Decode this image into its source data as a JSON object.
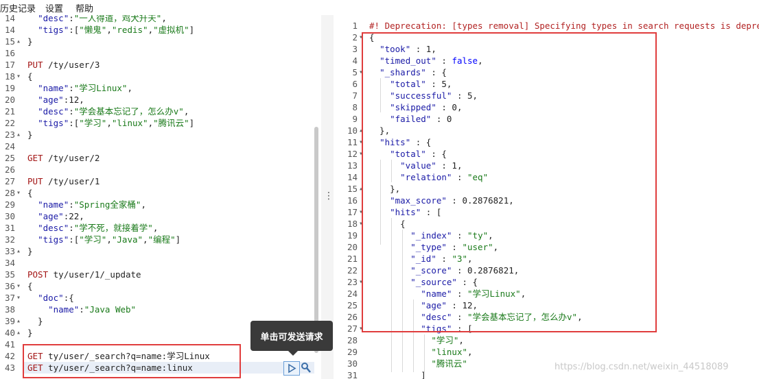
{
  "menu": {
    "history": "历史记录",
    "settings": "设置",
    "help": "帮助"
  },
  "tooltip": "单击可发送请求",
  "watermark": "https://blog.csdn.net/weixin_44518089",
  "left_editor": {
    "lines": [
      {
        "n": "14",
        "fold": "",
        "text": [
          [
            "  ",
            "tk-plain"
          ],
          [
            "\"desc\"",
            "tk-key"
          ],
          [
            ":",
            "tk-plain"
          ],
          [
            "\"一人得道，鸡犬升天\"",
            "tk-str"
          ],
          [
            ",",
            "tk-plain"
          ]
        ]
      },
      {
        "n": "14",
        "fold": "",
        "text": [
          [
            "  ",
            "tk-plain"
          ],
          [
            "\"tigs\"",
            "tk-key"
          ],
          [
            ":[",
            "tk-plain"
          ],
          [
            "\"懒鬼\"",
            "tk-str"
          ],
          [
            ",",
            "tk-plain"
          ],
          [
            "\"redis\"",
            "tk-str"
          ],
          [
            ",",
            "tk-plain"
          ],
          [
            "\"虚拟机\"",
            "tk-str"
          ],
          [
            "]",
            "tk-plain"
          ]
        ]
      },
      {
        "n": "15",
        "fold": "▴",
        "text": [
          [
            "}",
            "tk-plain"
          ]
        ]
      },
      {
        "n": "16",
        "fold": "",
        "text": []
      },
      {
        "n": "17",
        "fold": "",
        "text": [
          [
            "PUT ",
            "tk-kw"
          ],
          [
            "/ty/user/3",
            "tk-plain"
          ]
        ]
      },
      {
        "n": "18",
        "fold": "▾",
        "text": [
          [
            "{",
            "tk-plain"
          ]
        ]
      },
      {
        "n": "19",
        "fold": "",
        "text": [
          [
            "  ",
            "tk-plain"
          ],
          [
            "\"name\"",
            "tk-key"
          ],
          [
            ":",
            "tk-plain"
          ],
          [
            "\"学习Linux\"",
            "tk-str"
          ],
          [
            ",",
            "tk-plain"
          ]
        ]
      },
      {
        "n": "20",
        "fold": "",
        "text": [
          [
            "  ",
            "tk-plain"
          ],
          [
            "\"age\"",
            "tk-key"
          ],
          [
            ":12,",
            "tk-plain"
          ]
        ]
      },
      {
        "n": "21",
        "fold": "",
        "text": [
          [
            "  ",
            "tk-plain"
          ],
          [
            "\"desc\"",
            "tk-key"
          ],
          [
            ":",
            "tk-plain"
          ],
          [
            "\"学会基本忘记了，怎么办v\"",
            "tk-str"
          ],
          [
            ",",
            "tk-plain"
          ]
        ]
      },
      {
        "n": "22",
        "fold": "",
        "text": [
          [
            "  ",
            "tk-plain"
          ],
          [
            "\"tigs\"",
            "tk-key"
          ],
          [
            ":[",
            "tk-plain"
          ],
          [
            "\"学习\"",
            "tk-str"
          ],
          [
            ",",
            "tk-plain"
          ],
          [
            "\"linux\"",
            "tk-str"
          ],
          [
            ",",
            "tk-plain"
          ],
          [
            "\"腾讯云\"",
            "tk-str"
          ],
          [
            "]",
            "tk-plain"
          ]
        ]
      },
      {
        "n": "23",
        "fold": "▴",
        "text": [
          [
            "}",
            "tk-plain"
          ]
        ]
      },
      {
        "n": "24",
        "fold": "",
        "text": []
      },
      {
        "n": "25",
        "fold": "",
        "text": [
          [
            "GET ",
            "tk-kw"
          ],
          [
            "/ty/user/2",
            "tk-plain"
          ]
        ]
      },
      {
        "n": "26",
        "fold": "",
        "text": []
      },
      {
        "n": "27",
        "fold": "",
        "text": [
          [
            "PUT ",
            "tk-kw"
          ],
          [
            "/ty/user/1",
            "tk-plain"
          ]
        ]
      },
      {
        "n": "28",
        "fold": "▾",
        "text": [
          [
            "{",
            "tk-plain"
          ]
        ]
      },
      {
        "n": "29",
        "fold": "",
        "text": [
          [
            "  ",
            "tk-plain"
          ],
          [
            "\"name\"",
            "tk-key"
          ],
          [
            ":",
            "tk-plain"
          ],
          [
            "\"Spring全家桶\"",
            "tk-str"
          ],
          [
            ",",
            "tk-plain"
          ]
        ]
      },
      {
        "n": "30",
        "fold": "",
        "text": [
          [
            "  ",
            "tk-plain"
          ],
          [
            "\"age\"",
            "tk-key"
          ],
          [
            ":22,",
            "tk-plain"
          ]
        ]
      },
      {
        "n": "31",
        "fold": "",
        "text": [
          [
            "  ",
            "tk-plain"
          ],
          [
            "\"desc\"",
            "tk-key"
          ],
          [
            ":",
            "tk-plain"
          ],
          [
            "\"学不死，就接着学\"",
            "tk-str"
          ],
          [
            ",",
            "tk-plain"
          ]
        ]
      },
      {
        "n": "32",
        "fold": "",
        "text": [
          [
            "  ",
            "tk-plain"
          ],
          [
            "\"tigs\"",
            "tk-key"
          ],
          [
            ":[",
            "tk-plain"
          ],
          [
            "\"学习\"",
            "tk-str"
          ],
          [
            ",",
            "tk-plain"
          ],
          [
            "\"Java\"",
            "tk-str"
          ],
          [
            ",",
            "tk-plain"
          ],
          [
            "\"编程\"",
            "tk-str"
          ],
          [
            "]",
            "tk-plain"
          ]
        ]
      },
      {
        "n": "33",
        "fold": "▴",
        "text": [
          [
            "}",
            "tk-plain"
          ]
        ]
      },
      {
        "n": "34",
        "fold": "",
        "text": []
      },
      {
        "n": "35",
        "fold": "",
        "text": [
          [
            "POST ",
            "tk-kw"
          ],
          [
            "ty/user/1/_update",
            "tk-plain"
          ]
        ]
      },
      {
        "n": "36",
        "fold": "▾",
        "text": [
          [
            "{",
            "tk-plain"
          ]
        ]
      },
      {
        "n": "37",
        "fold": "▾",
        "text": [
          [
            "  ",
            "tk-plain"
          ],
          [
            "\"doc\"",
            "tk-key"
          ],
          [
            ":{",
            "tk-plain"
          ]
        ]
      },
      {
        "n": "38",
        "fold": "",
        "text": [
          [
            "    ",
            "tk-plain"
          ],
          [
            "\"name\"",
            "tk-key"
          ],
          [
            ":",
            "tk-plain"
          ],
          [
            "\"Java Web\"",
            "tk-str"
          ]
        ]
      },
      {
        "n": "39",
        "fold": "▴",
        "text": [
          [
            "  }",
            "tk-plain"
          ]
        ]
      },
      {
        "n": "40",
        "fold": "▴",
        "text": [
          [
            "}",
            "tk-plain"
          ]
        ]
      },
      {
        "n": "41",
        "fold": "",
        "text": []
      },
      {
        "n": "42",
        "fold": "",
        "text": [
          [
            "GET ",
            "tk-kw"
          ],
          [
            "ty/user/_search?q=name:学习Linux",
            "tk-plain"
          ]
        ]
      },
      {
        "n": "43",
        "fold": "",
        "text": [
          [
            "GET ",
            "tk-kw"
          ],
          [
            "ty/user/_search?q=name:linux",
            "tk-plain"
          ]
        ]
      }
    ]
  },
  "right_editor": {
    "lines": [
      {
        "n": "1",
        "fold": "",
        "text": [
          [
            "#! Deprecation: [types removal] Specifying types in search requests is deprecated.",
            "tk-comment"
          ]
        ]
      },
      {
        "n": "2",
        "fold": "▾",
        "text": [
          [
            "{",
            "tk-plain"
          ]
        ]
      },
      {
        "n": "3",
        "fold": "",
        "text": [
          [
            "  ",
            "tk-plain"
          ],
          [
            "\"took\"",
            "tk-key"
          ],
          [
            " : 1,",
            "tk-plain"
          ]
        ]
      },
      {
        "n": "4",
        "fold": "",
        "text": [
          [
            "  ",
            "tk-plain"
          ],
          [
            "\"timed_out\"",
            "tk-key"
          ],
          [
            " : ",
            "tk-plain"
          ],
          [
            "false",
            "tk-bool"
          ],
          [
            ",",
            "tk-plain"
          ]
        ]
      },
      {
        "n": "5",
        "fold": "▾",
        "text": [
          [
            "  ",
            "tk-plain"
          ],
          [
            "\"_shards\"",
            "tk-key"
          ],
          [
            " : {",
            "tk-plain"
          ]
        ]
      },
      {
        "n": "6",
        "fold": "",
        "text": [
          [
            "    ",
            "tk-plain"
          ],
          [
            "\"total\"",
            "tk-key"
          ],
          [
            " : 5,",
            "tk-plain"
          ]
        ]
      },
      {
        "n": "7",
        "fold": "",
        "text": [
          [
            "    ",
            "tk-plain"
          ],
          [
            "\"successful\"",
            "tk-key"
          ],
          [
            " : 5,",
            "tk-plain"
          ]
        ]
      },
      {
        "n": "8",
        "fold": "",
        "text": [
          [
            "    ",
            "tk-plain"
          ],
          [
            "\"skipped\"",
            "tk-key"
          ],
          [
            " : 0,",
            "tk-plain"
          ]
        ]
      },
      {
        "n": "9",
        "fold": "",
        "text": [
          [
            "    ",
            "tk-plain"
          ],
          [
            "\"failed\"",
            "tk-key"
          ],
          [
            " : 0",
            "tk-plain"
          ]
        ]
      },
      {
        "n": "10",
        "fold": "▴",
        "text": [
          [
            "  },",
            "tk-plain"
          ]
        ]
      },
      {
        "n": "11",
        "fold": "▾",
        "text": [
          [
            "  ",
            "tk-plain"
          ],
          [
            "\"hits\"",
            "tk-key"
          ],
          [
            " : {",
            "tk-plain"
          ]
        ]
      },
      {
        "n": "12",
        "fold": "▾",
        "text": [
          [
            "    ",
            "tk-plain"
          ],
          [
            "\"total\"",
            "tk-key"
          ],
          [
            " : {",
            "tk-plain"
          ]
        ]
      },
      {
        "n": "13",
        "fold": "",
        "text": [
          [
            "      ",
            "tk-plain"
          ],
          [
            "\"value\"",
            "tk-key"
          ],
          [
            " : 1,",
            "tk-plain"
          ]
        ]
      },
      {
        "n": "14",
        "fold": "",
        "text": [
          [
            "      ",
            "tk-plain"
          ],
          [
            "\"relation\"",
            "tk-key"
          ],
          [
            " : ",
            "tk-plain"
          ],
          [
            "\"eq\"",
            "tk-str"
          ]
        ]
      },
      {
        "n": "15",
        "fold": "▴",
        "text": [
          [
            "    },",
            "tk-plain"
          ]
        ]
      },
      {
        "n": "16",
        "fold": "",
        "text": [
          [
            "    ",
            "tk-plain"
          ],
          [
            "\"max_score\"",
            "tk-key"
          ],
          [
            " : 0.2876821,",
            "tk-plain"
          ]
        ]
      },
      {
        "n": "17",
        "fold": "▾",
        "text": [
          [
            "    ",
            "tk-plain"
          ],
          [
            "\"hits\"",
            "tk-key"
          ],
          [
            " : [",
            "tk-plain"
          ]
        ]
      },
      {
        "n": "18",
        "fold": "▾",
        "text": [
          [
            "      {",
            "tk-plain"
          ]
        ]
      },
      {
        "n": "19",
        "fold": "",
        "text": [
          [
            "        ",
            "tk-plain"
          ],
          [
            "\"_index\"",
            "tk-key"
          ],
          [
            " : ",
            "tk-plain"
          ],
          [
            "\"ty\"",
            "tk-str"
          ],
          [
            ",",
            "tk-plain"
          ]
        ]
      },
      {
        "n": "20",
        "fold": "",
        "text": [
          [
            "        ",
            "tk-plain"
          ],
          [
            "\"_type\"",
            "tk-key"
          ],
          [
            " : ",
            "tk-plain"
          ],
          [
            "\"user\"",
            "tk-str"
          ],
          [
            ",",
            "tk-plain"
          ]
        ]
      },
      {
        "n": "21",
        "fold": "",
        "text": [
          [
            "        ",
            "tk-plain"
          ],
          [
            "\"_id\"",
            "tk-key"
          ],
          [
            " : ",
            "tk-plain"
          ],
          [
            "\"3\"",
            "tk-str"
          ],
          [
            ",",
            "tk-plain"
          ]
        ]
      },
      {
        "n": "22",
        "fold": "",
        "text": [
          [
            "        ",
            "tk-plain"
          ],
          [
            "\"_score\"",
            "tk-key"
          ],
          [
            " : 0.2876821,",
            "tk-plain"
          ]
        ]
      },
      {
        "n": "23",
        "fold": "▾",
        "text": [
          [
            "        ",
            "tk-plain"
          ],
          [
            "\"_source\"",
            "tk-key"
          ],
          [
            " : {",
            "tk-plain"
          ]
        ]
      },
      {
        "n": "24",
        "fold": "",
        "text": [
          [
            "          ",
            "tk-plain"
          ],
          [
            "\"name\"",
            "tk-key"
          ],
          [
            " : ",
            "tk-plain"
          ],
          [
            "\"学习Linux\"",
            "tk-str"
          ],
          [
            ",",
            "tk-plain"
          ]
        ]
      },
      {
        "n": "25",
        "fold": "",
        "text": [
          [
            "          ",
            "tk-plain"
          ],
          [
            "\"age\"",
            "tk-key"
          ],
          [
            " : 12,",
            "tk-plain"
          ]
        ]
      },
      {
        "n": "26",
        "fold": "",
        "text": [
          [
            "          ",
            "tk-plain"
          ],
          [
            "\"desc\"",
            "tk-key"
          ],
          [
            " : ",
            "tk-plain"
          ],
          [
            "\"学会基本忘记了，怎么办v\"",
            "tk-str"
          ],
          [
            ",",
            "tk-plain"
          ]
        ]
      },
      {
        "n": "27",
        "fold": "▾",
        "text": [
          [
            "          ",
            "tk-plain"
          ],
          [
            "\"tigs\"",
            "tk-key"
          ],
          [
            " : [",
            "tk-plain"
          ]
        ]
      },
      {
        "n": "28",
        "fold": "",
        "text": [
          [
            "            ",
            "tk-plain"
          ],
          [
            "\"学习\"",
            "tk-str"
          ],
          [
            ",",
            "tk-plain"
          ]
        ]
      },
      {
        "n": "29",
        "fold": "",
        "text": [
          [
            "            ",
            "tk-plain"
          ],
          [
            "\"linux\"",
            "tk-str"
          ],
          [
            ",",
            "tk-plain"
          ]
        ]
      },
      {
        "n": "30",
        "fold": "",
        "text": [
          [
            "            ",
            "tk-plain"
          ],
          [
            "\"腾讯云\"",
            "tk-str"
          ]
        ]
      },
      {
        "n": "31",
        "fold": "",
        "text": [
          [
            "          ]",
            "tk-plain"
          ]
        ]
      }
    ]
  },
  "colors": {
    "highlight_box": "#e03c3c",
    "active_line": "#e8eef7"
  }
}
